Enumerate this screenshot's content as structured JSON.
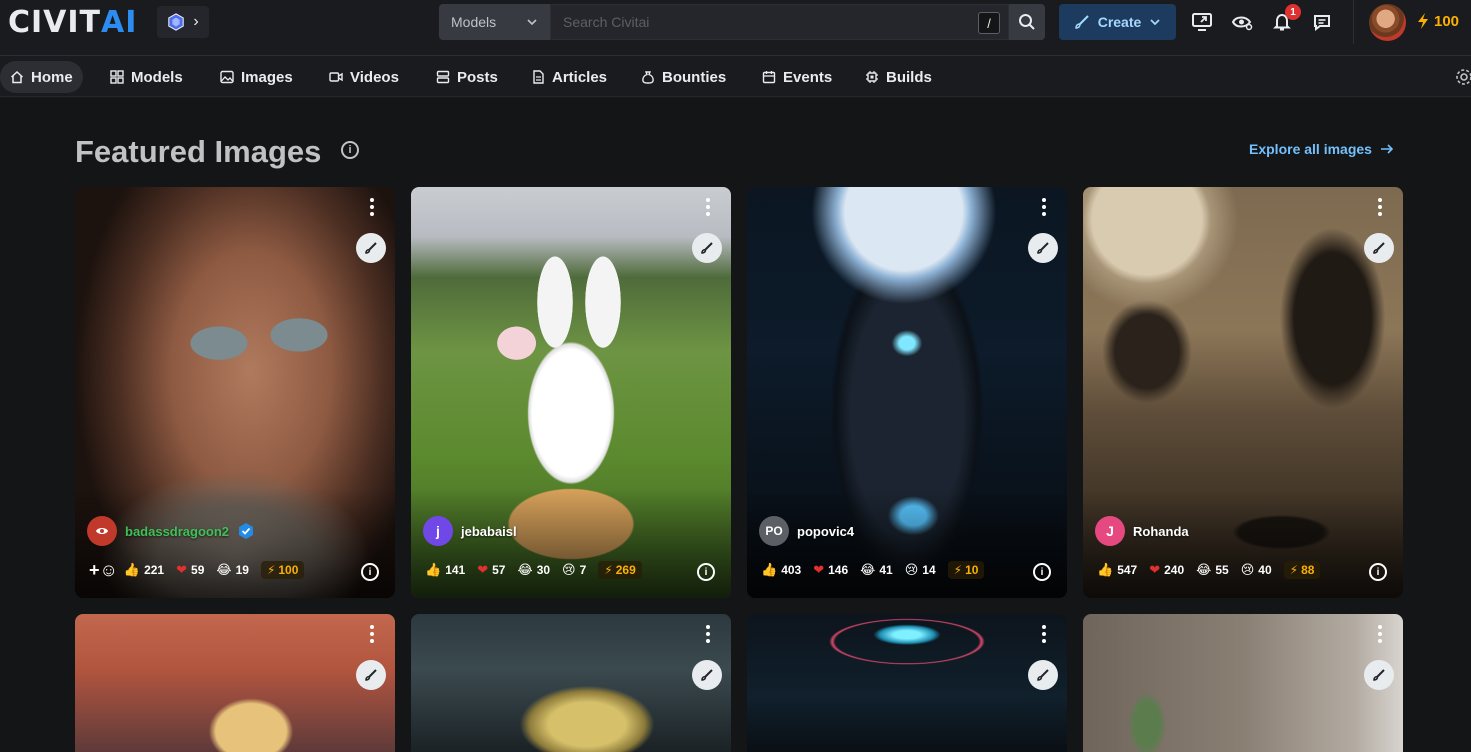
{
  "header": {
    "logo_left": "CIVIT",
    "logo_right": "AI",
    "search_type": "Models",
    "search_placeholder": "Search Civitai",
    "search_shortcut": "/",
    "create_label": "Create",
    "notification_count": "1",
    "buzz_balance": "100"
  },
  "nav": {
    "items": [
      {
        "label": "Home"
      },
      {
        "label": "Models"
      },
      {
        "label": "Images"
      },
      {
        "label": "Videos"
      },
      {
        "label": "Posts"
      },
      {
        "label": "Articles"
      },
      {
        "label": "Bounties"
      },
      {
        "label": "Events"
      },
      {
        "label": "Builds"
      }
    ]
  },
  "section": {
    "title": "Featured Images",
    "explore_label": "Explore all images"
  },
  "cards": [
    {
      "user": "badassdragoon2",
      "avatar_text": "",
      "thumbs": "221",
      "hearts": "59",
      "laugh": "19",
      "cry": "",
      "buzz": "100"
    },
    {
      "user": "jebabaisl",
      "avatar_text": "j",
      "thumbs": "141",
      "hearts": "57",
      "laugh": "30",
      "cry": "7",
      "buzz": "269"
    },
    {
      "user": "popovic4",
      "avatar_text": "PO",
      "thumbs": "403",
      "hearts": "146",
      "laugh": "41",
      "cry": "14",
      "buzz": "10"
    },
    {
      "user": "Rohanda",
      "avatar_text": "J",
      "thumbs": "547",
      "hearts": "240",
      "laugh": "55",
      "cry": "40",
      "buzz": "88"
    }
  ],
  "colors": {
    "background": "#141517",
    "header": "#1a1b1e",
    "accent_blue": "#74c0fc",
    "buzz_yellow": "#fab005",
    "badge_red": "#e03131"
  }
}
